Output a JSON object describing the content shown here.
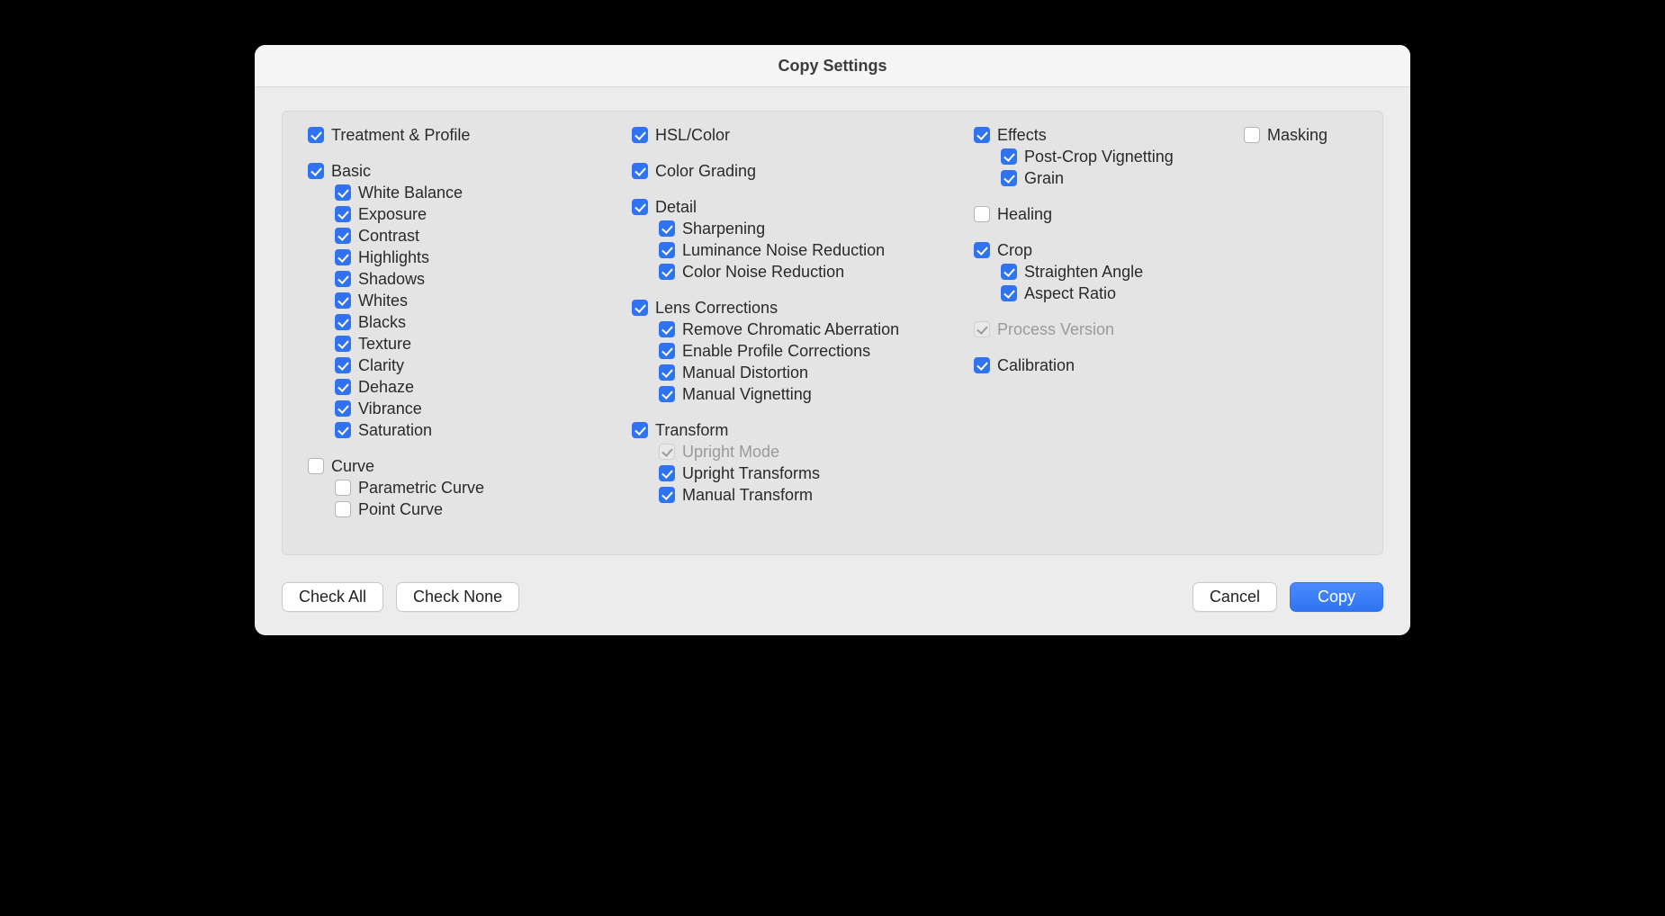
{
  "dialog": {
    "title": "Copy Settings",
    "buttons": {
      "check_all": "Check All",
      "check_none": "Check None",
      "cancel": "Cancel",
      "copy": "Copy"
    }
  },
  "col1": {
    "treatment_profile": {
      "label": "Treatment & Profile",
      "checked": true
    },
    "basic": {
      "label": "Basic",
      "checked": true,
      "items": [
        {
          "key": "white_balance",
          "label": "White Balance",
          "checked": true
        },
        {
          "key": "exposure",
          "label": "Exposure",
          "checked": true
        },
        {
          "key": "contrast",
          "label": "Contrast",
          "checked": true
        },
        {
          "key": "highlights",
          "label": "Highlights",
          "checked": true
        },
        {
          "key": "shadows",
          "label": "Shadows",
          "checked": true
        },
        {
          "key": "whites",
          "label": "Whites",
          "checked": true
        },
        {
          "key": "blacks",
          "label": "Blacks",
          "checked": true
        },
        {
          "key": "texture",
          "label": "Texture",
          "checked": true
        },
        {
          "key": "clarity",
          "label": "Clarity",
          "checked": true
        },
        {
          "key": "dehaze",
          "label": "Dehaze",
          "checked": true
        },
        {
          "key": "vibrance",
          "label": "Vibrance",
          "checked": true
        },
        {
          "key": "saturation",
          "label": "Saturation",
          "checked": true
        }
      ]
    },
    "curve": {
      "label": "Curve",
      "checked": false,
      "items": [
        {
          "key": "parametric_curve",
          "label": "Parametric Curve",
          "checked": false
        },
        {
          "key": "point_curve",
          "label": "Point Curve",
          "checked": false
        }
      ]
    }
  },
  "col2": {
    "hsl_color": {
      "label": "HSL/Color",
      "checked": true
    },
    "color_grading": {
      "label": "Color Grading",
      "checked": true
    },
    "detail": {
      "label": "Detail",
      "checked": true,
      "items": [
        {
          "key": "sharpening",
          "label": "Sharpening",
          "checked": true
        },
        {
          "key": "luminance_nr",
          "label": "Luminance Noise Reduction",
          "checked": true
        },
        {
          "key": "color_nr",
          "label": "Color Noise Reduction",
          "checked": true
        }
      ]
    },
    "lens": {
      "label": "Lens Corrections",
      "checked": true,
      "items": [
        {
          "key": "remove_ca",
          "label": "Remove Chromatic Aberration",
          "checked": true
        },
        {
          "key": "enable_profile",
          "label": "Enable Profile Corrections",
          "checked": true
        },
        {
          "key": "manual_distortion",
          "label": "Manual Distortion",
          "checked": true
        },
        {
          "key": "manual_vignetting",
          "label": "Manual Vignetting",
          "checked": true
        }
      ]
    },
    "transform": {
      "label": "Transform",
      "checked": true,
      "items": [
        {
          "key": "upright_mode",
          "label": "Upright Mode",
          "checked": true,
          "disabled": true
        },
        {
          "key": "upright_transforms",
          "label": "Upright Transforms",
          "checked": true
        },
        {
          "key": "manual_transform",
          "label": "Manual Transform",
          "checked": true
        }
      ]
    }
  },
  "col3": {
    "effects": {
      "label": "Effects",
      "checked": true,
      "items": [
        {
          "key": "post_crop_vignetting",
          "label": "Post-Crop Vignetting",
          "checked": true
        },
        {
          "key": "grain",
          "label": "Grain",
          "checked": true
        }
      ]
    },
    "healing": {
      "label": "Healing",
      "checked": false
    },
    "crop": {
      "label": "Crop",
      "checked": true,
      "items": [
        {
          "key": "straighten_angle",
          "label": "Straighten Angle",
          "checked": true
        },
        {
          "key": "aspect_ratio",
          "label": "Aspect Ratio",
          "checked": true
        }
      ]
    },
    "process_version": {
      "label": "Process Version",
      "checked": true,
      "disabled": true
    },
    "calibration": {
      "label": "Calibration",
      "checked": true
    }
  },
  "col4": {
    "masking": {
      "label": "Masking",
      "checked": false
    }
  }
}
